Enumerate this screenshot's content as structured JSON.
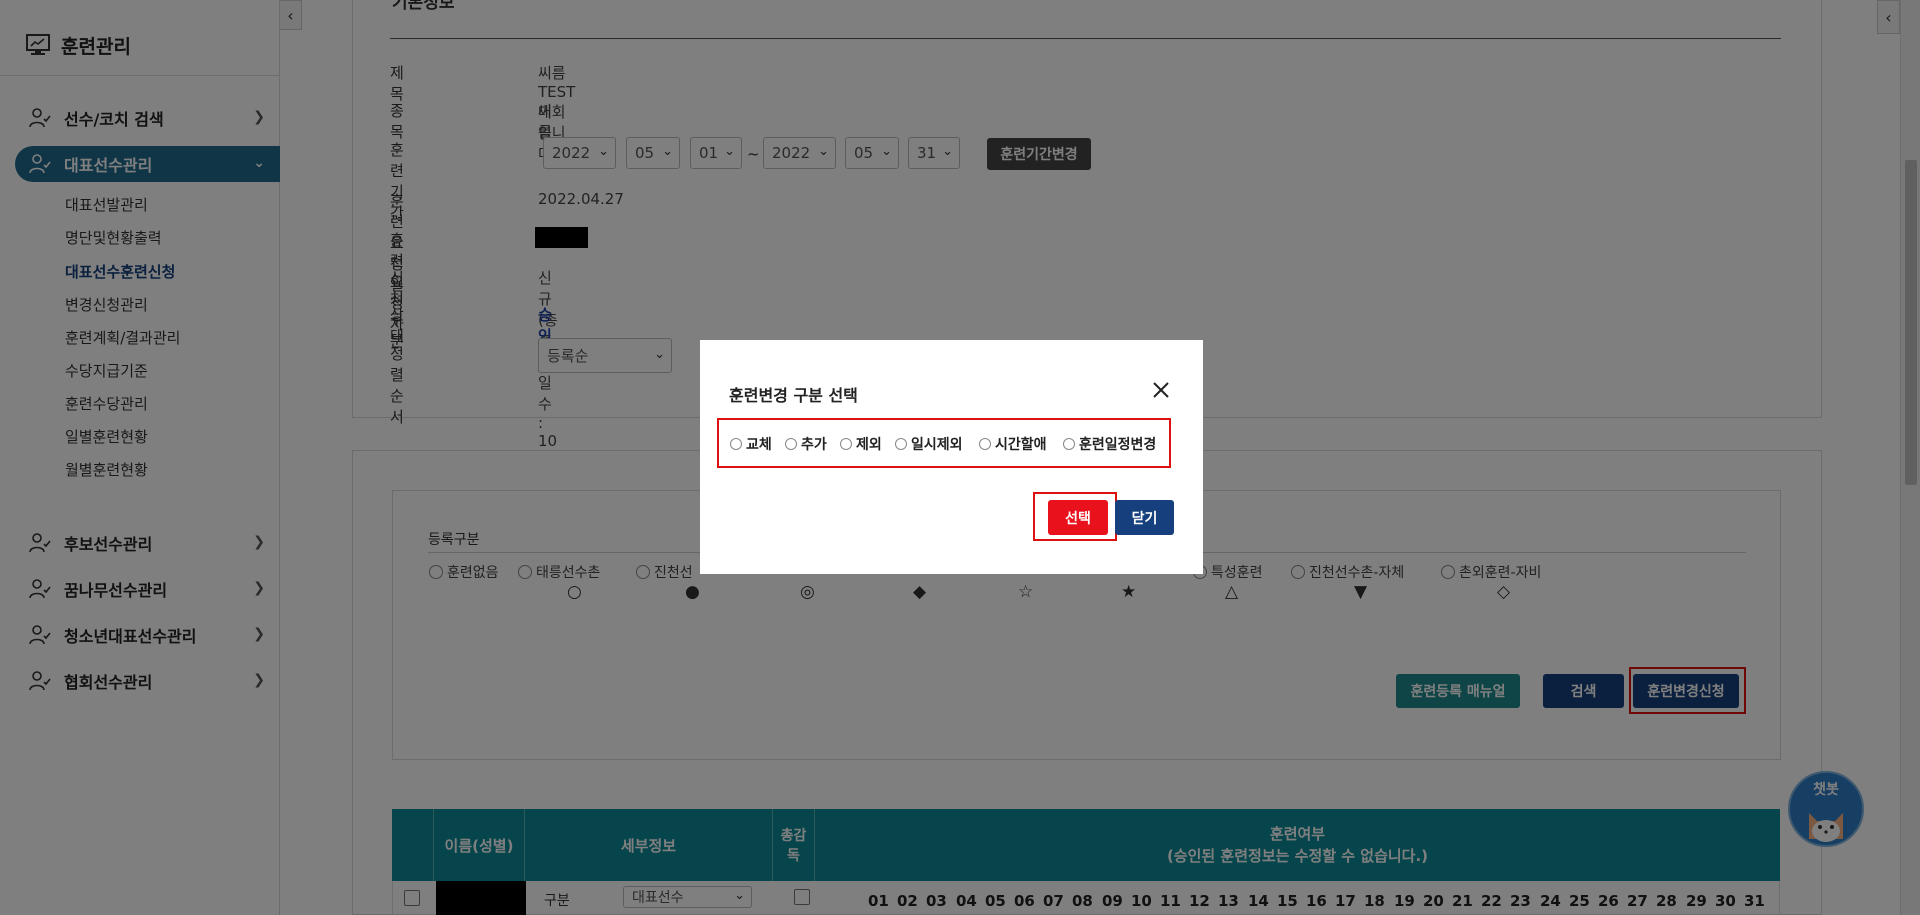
{
  "sidebar": {
    "title": "훈련관리",
    "menu": [
      {
        "label": "선수/코치 검색"
      },
      {
        "label": "대표선수관리"
      },
      {
        "label": "후보선수관리"
      },
      {
        "label": "꿈나무선수관리"
      },
      {
        "label": "청소년대표선수관리"
      },
      {
        "label": "협회선수관리"
      }
    ],
    "submenu": [
      {
        "label": "대표선발관리"
      },
      {
        "label": "명단및현황출력"
      },
      {
        "label": "대표선수훈련신청"
      },
      {
        "label": "변경신청관리"
      },
      {
        "label": "훈련계획/결과관리"
      },
      {
        "label": "수당지급기준"
      },
      {
        "label": "훈련수당관리"
      },
      {
        "label": "일별훈련현황"
      },
      {
        "label": "월별훈련현황"
      }
    ]
  },
  "info": {
    "section_title": "기본정보",
    "title_label": "제목",
    "title_value": "씨름 TEST 대회입니다.",
    "sport_label": "종목",
    "sport_value": "씨름",
    "period_label": "훈련기간",
    "start_year": "2022",
    "start_month": "05",
    "start_day": "01",
    "tilde": "~",
    "end_year": "2022",
    "end_month": "05",
    "end_day": "31",
    "change_period_button": "훈련기간변경",
    "request_date_label": "훈련요청일",
    "request_date_value": "2022.04.27",
    "requester_label": "훈련요청자",
    "apply_type_label": "신청구분",
    "apply_type_value": "신규 (총 훈련일수 : 10일)",
    "status_label": "상태",
    "status_value": "승인",
    "sort_label": "정렬순서",
    "sort_value": "등록순"
  },
  "registration": {
    "label": "등록구분",
    "options": [
      "훈련없음",
      "태릉선수촌",
      "진천선",
      "특성훈련",
      "진천선수촌-자체",
      "촌외훈련-자비"
    ],
    "symbols": [
      "○",
      "●",
      "◎",
      "◆",
      "☆",
      "★",
      "△",
      "▼",
      "◇"
    ]
  },
  "buttons": {
    "manual": "훈련등록 매뉴얼",
    "search": "검색",
    "change_request": "훈련변경신청"
  },
  "table": {
    "col_name": "이름(성별)",
    "col_detail": "세부정보",
    "col_supervisor": "총감\n독",
    "col_training": "훈련여부\n(승인된 훈련정보는 수정할 수 없습니다.)",
    "row_type_label": "구분",
    "row_type_value": "대표선수",
    "days": [
      "01",
      "02",
      "03",
      "04",
      "05",
      "06",
      "07",
      "08",
      "09",
      "10",
      "11",
      "12",
      "13",
      "14",
      "15",
      "16",
      "17",
      "18",
      "19",
      "20",
      "21",
      "22",
      "23",
      "24",
      "25",
      "26",
      "27",
      "28",
      "29",
      "30",
      "31"
    ]
  },
  "modal": {
    "title": "훈련변경 구분 선택",
    "options": [
      "교체",
      "추가",
      "제외",
      "일시제외",
      "시간할애",
      "훈련일정변경"
    ],
    "select_button": "선택",
    "close_button": "닫기"
  },
  "chatbot": {
    "label": "챗봇"
  },
  "colors": {
    "sidebar_active": "#1e6a8e",
    "table_header": "#0a8a96",
    "manual_button": "#1f8a8e",
    "primary_button": "#15407d",
    "select_button": "#e8111c",
    "highlight": "#dd1111"
  }
}
